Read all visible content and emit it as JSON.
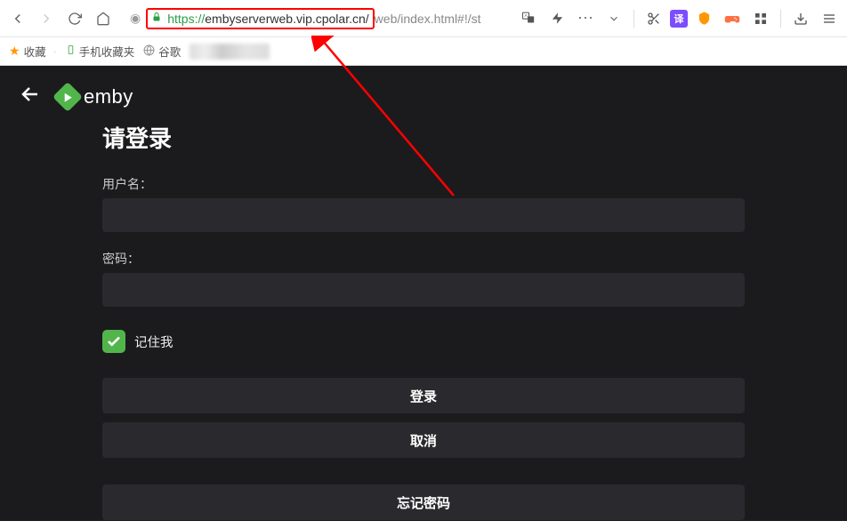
{
  "browser": {
    "url_https": "https://",
    "url_domain": "embyserverweb.vip.cpolar.cn/",
    "url_path": "web/index.html#!/st"
  },
  "bookmarks": {
    "favorites": "收藏",
    "mobile": "手机收藏夹",
    "google": "谷歌"
  },
  "login": {
    "title": "请登录",
    "username_label": "用户名：",
    "password_label": "密码：",
    "remember_label": "记住我",
    "login_button": "登录",
    "cancel_button": "取消",
    "forgot_button": "忘记密码"
  },
  "logo_text": "emby"
}
